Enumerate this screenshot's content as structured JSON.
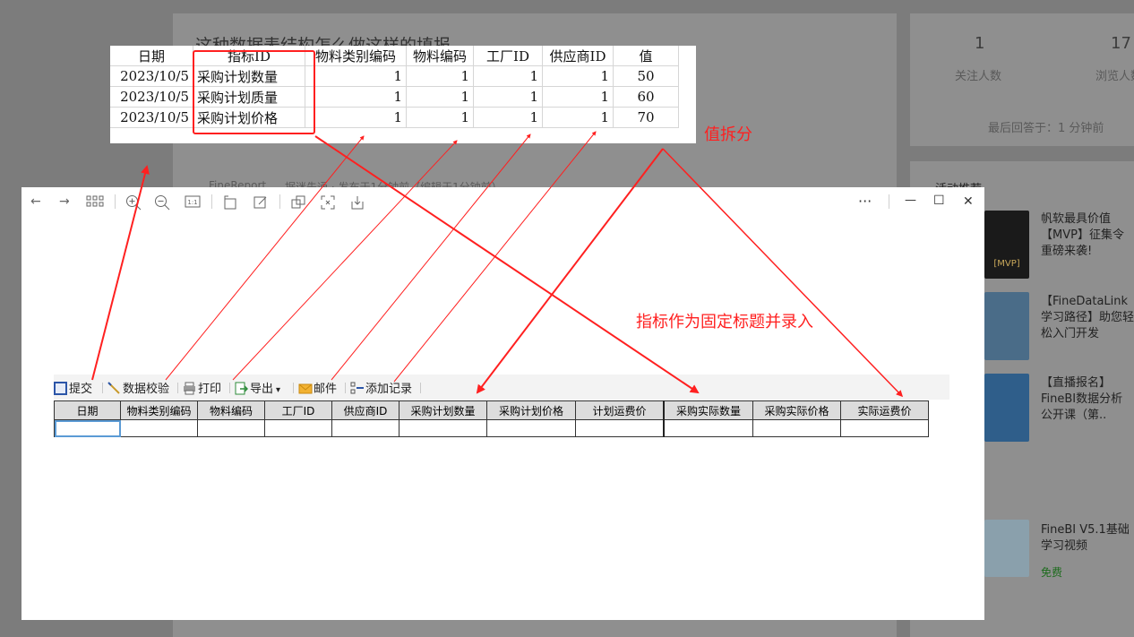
{
  "background": {
    "question_title": "这种数据表结构怎么做这样的填报",
    "tag": "FineReport",
    "user_and_time": "据迷先通 · 发布于1分钟前（编辑于1分钟前）",
    "stats": [
      {
        "value": "1",
        "label": "关注人数"
      },
      {
        "value": "17",
        "label": "浏览人数"
      }
    ],
    "last_answer": "最后回答于：1 分钟前",
    "section_title": "活动推荐",
    "recommendations": [
      {
        "text": "帆软最具价值【MVP】征集令重磅来袭!",
        "thumb_text": "[MVP]"
      },
      {
        "text": "【FineDataLink学习路径】助您轻松入门开发"
      },
      {
        "text": "【直播报名】FineBI数据分析公开课（第..期）：一个案 ..."
      },
      {
        "text": "FineBI V5.1基础学习视频",
        "badge": "免费"
      }
    ]
  },
  "excel": {
    "headers": [
      "日期",
      "指标ID",
      "物料类别编码",
      "物料编码",
      "工厂ID",
      "供应商ID",
      "值"
    ],
    "rows": [
      [
        "2023/10/5",
        "采购计划数量",
        "1",
        "1",
        "1",
        "1",
        "50"
      ],
      [
        "2023/10/5",
        "采购计划质量",
        "1",
        "1",
        "1",
        "1",
        "60"
      ],
      [
        "2023/10/5",
        "采购计划价格",
        "1",
        "1",
        "1",
        "1",
        "70"
      ]
    ]
  },
  "window": {
    "menu_dots": "···",
    "minimize": "—",
    "maximize": "☐",
    "close": "✕"
  },
  "report_toolbar": [
    {
      "label": "提交",
      "icon": "save-icon"
    },
    {
      "label": "数据校验",
      "icon": "validate-icon"
    },
    {
      "label": "打印",
      "icon": "print-icon"
    },
    {
      "label": "导出",
      "icon": "export-icon",
      "dropdown": "▾"
    },
    {
      "label": "邮件",
      "icon": "mail-icon"
    },
    {
      "label": "添加记录",
      "icon": "add-record-icon"
    }
  ],
  "report_table": {
    "headers": [
      "日期",
      "物料类别编码",
      "物料编码",
      "工厂ID",
      "供应商ID",
      "采购计划数量",
      "采购计划价格",
      "计划运费价",
      "采购实际数量",
      "采购实际价格",
      "实际运费价"
    ]
  },
  "annotations": {
    "value_split": "值拆分",
    "indicator_note": "指标作为固定标题并录入"
  },
  "colors": {
    "annotation_red": "#ff2020",
    "header_gray": "#dcdcdc"
  }
}
